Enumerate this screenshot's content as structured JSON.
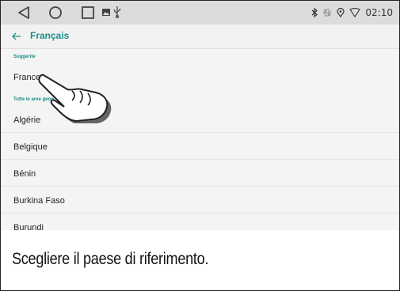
{
  "status_bar": {
    "time": "02:10",
    "bg_color": "#dcdcdc",
    "icons": [
      "back-triangle-icon",
      "home-circle-icon",
      "recents-square-icon",
      "image-icon",
      "usb-icon",
      "bluetooth-icon",
      "vibrate-icon",
      "location-icon",
      "wifi-icon"
    ]
  },
  "header": {
    "title": "Français",
    "accent_color": "#1e8c86"
  },
  "list": {
    "suggested_label": "Suggerite",
    "suggested": [
      {
        "label": "France"
      }
    ],
    "all_label": "Tutte le aree geog",
    "countries": [
      {
        "label": "Algérie"
      },
      {
        "label": "Belgique"
      },
      {
        "label": "Bénin"
      },
      {
        "label": "Burkina Faso"
      },
      {
        "label": "Burundi"
      }
    ]
  },
  "caption": {
    "text": "Scegliere il paese di riferimento."
  }
}
